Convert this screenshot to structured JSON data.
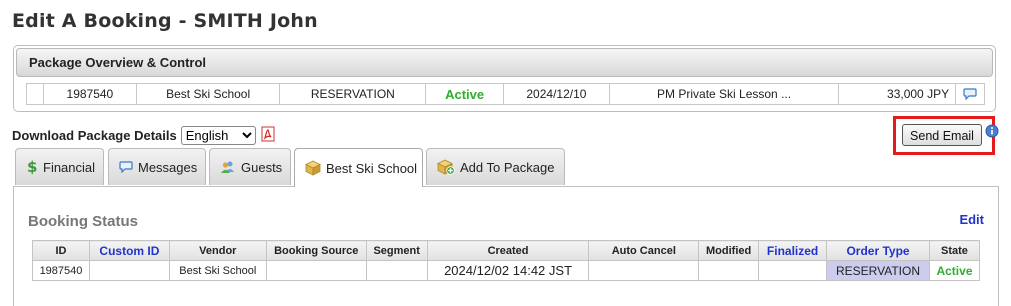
{
  "page": {
    "title": "Edit A Booking - SMITH John"
  },
  "package_overview": {
    "header": "Package Overview & Control",
    "row": {
      "id": "1987540",
      "vendor": "Best Ski School",
      "type": "RESERVATION",
      "status": "Active",
      "date": "2024/12/10",
      "description": "PM Private Ski Lesson ...",
      "price": "33,000 JPY"
    }
  },
  "download": {
    "label": "Download Package Details",
    "language_selected": "English"
  },
  "actions": {
    "send_email_label": "Send Email"
  },
  "tabs": [
    {
      "label": "Financial",
      "icon": "dollar-icon"
    },
    {
      "label": "Messages",
      "icon": "speech-bubble-icon"
    },
    {
      "label": "Guests",
      "icon": "users-icon"
    },
    {
      "label": "Best Ski School",
      "icon": "package-box-icon",
      "active": true
    },
    {
      "label": "Add To Package",
      "icon": "add-package-icon"
    }
  ],
  "booking_status": {
    "title": "Booking Status",
    "edit_label": "Edit",
    "columns": [
      "ID",
      "Custom ID",
      "Vendor",
      "Booking Source",
      "Segment",
      "Created",
      "Auto Cancel",
      "Modified",
      "Finalized",
      "Order Type",
      "State"
    ],
    "row": {
      "id": "1987540",
      "custom_id": "",
      "vendor": "Best Ski School",
      "booking_source": "",
      "segment": "",
      "created": "2024/12/02 14:42 JST",
      "auto_cancel": "",
      "modified": "",
      "finalized": "",
      "order_type": "RESERVATION",
      "state": "Active"
    }
  },
  "colors": {
    "active_green": "#2fae2f",
    "link_blue": "#2233cc",
    "highlight_red": "#e31b1b",
    "order_type_bg": "#ccccee"
  }
}
